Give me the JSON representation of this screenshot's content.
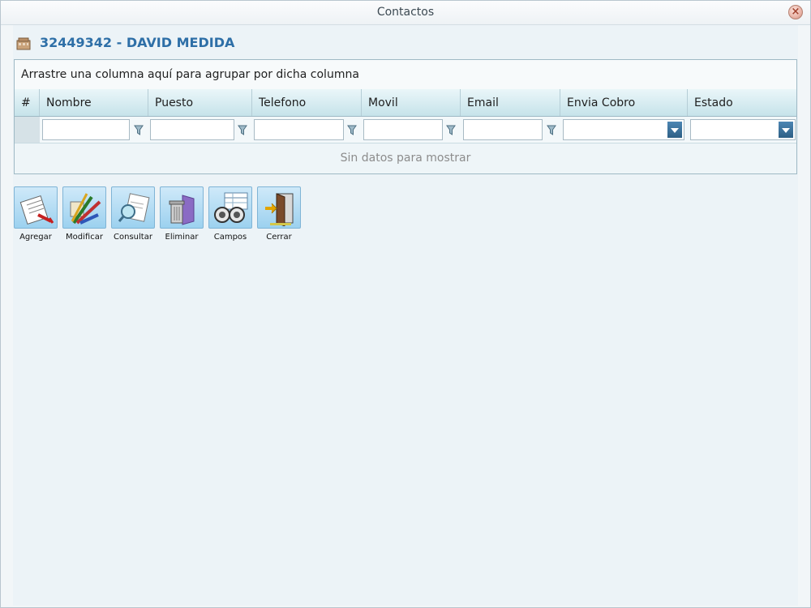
{
  "window": {
    "title": "Contactos"
  },
  "header": {
    "title": "32449342 - DAVID MEDIDA"
  },
  "grid": {
    "group_panel_text": "Arrastre una columna aquí para agrupar por dicha columna",
    "columns": [
      "#",
      "Nombre",
      "Puesto",
      "Telefono",
      "Movil",
      "Email",
      "Envia Cobro",
      "Estado"
    ],
    "filters": [
      "",
      "",
      "",
      "",
      "",
      "",
      ""
    ],
    "empty_text": "Sin datos para mostrar"
  },
  "toolbar": {
    "buttons": [
      {
        "label": "Agregar",
        "icon": "add-document-icon"
      },
      {
        "label": "Modificar",
        "icon": "pencils-icon"
      },
      {
        "label": "Consultar",
        "icon": "magnifier-document-icon"
      },
      {
        "label": "Eliminar",
        "icon": "trash-bin-icon"
      },
      {
        "label": "Campos",
        "icon": "binoculars-icon"
      },
      {
        "label": "Cerrar",
        "icon": "exit-door-icon"
      }
    ]
  },
  "colors": {
    "accent": "#2e6fa7",
    "header_gradient_bottom": "#c6e3ea",
    "button_bg": "#9cd1ef"
  }
}
